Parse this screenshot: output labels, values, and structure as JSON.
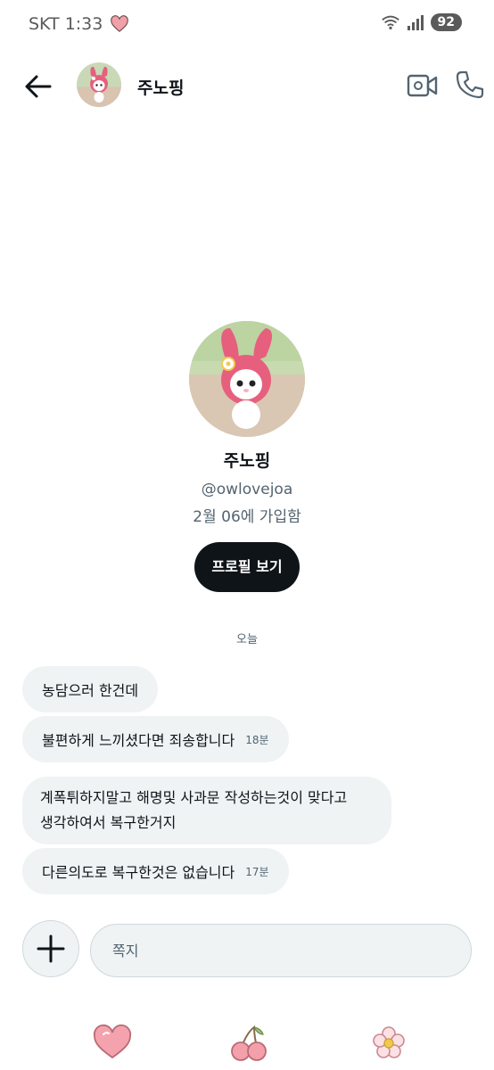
{
  "status_bar": {
    "carrier_time": "SKT 1:33",
    "battery": "92"
  },
  "header": {
    "name": "주노핑"
  },
  "profile": {
    "name": "주노핑",
    "handle": "@owlovejoa",
    "joined": "2월 06에 가입함",
    "view_profile_label": "프로필 보기"
  },
  "conversation": {
    "date_divider": "오늘",
    "messages": [
      {
        "text": "농담으러 한건데",
        "time": ""
      },
      {
        "text": "불편하게 느끼셨다면 죄송합니다",
        "time": "18분"
      },
      {
        "text_line1": "계폭튀하지말고 해명및 사과문 작성하는것이 맞다고",
        "text_line2": "생각하여서 복구한거지",
        "time": ""
      },
      {
        "text": "다른의도로 복구한것은 없습니다",
        "time": "17분"
      }
    ]
  },
  "composer": {
    "placeholder": "쪽지"
  },
  "colors": {
    "bubble_bg": "#eff3f4",
    "primary_button": "#0f1419",
    "secondary_text": "#536471",
    "nav_pink": "#e9808e"
  }
}
